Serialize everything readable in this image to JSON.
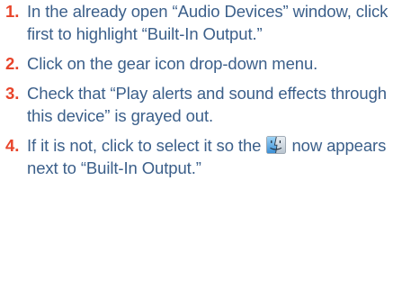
{
  "steps": [
    {
      "number": "1.",
      "text": "In the already open “Audio Devices” window, click first to highlight “Built-In Output.”"
    },
    {
      "number": "2.",
      "text": "Click on the gear icon drop-down menu."
    },
    {
      "number": "3.",
      "text": "Check that “Play alerts and sound effects through this device” is grayed out."
    },
    {
      "number": "4.",
      "text_before_icon": "If it is not, click to select it so the",
      "icon": "finder-icon",
      "text_after_icon": "now appears next to “Built-In Output.”"
    }
  ],
  "colors": {
    "number": "#e8442a",
    "text": "#3b5f8a"
  }
}
